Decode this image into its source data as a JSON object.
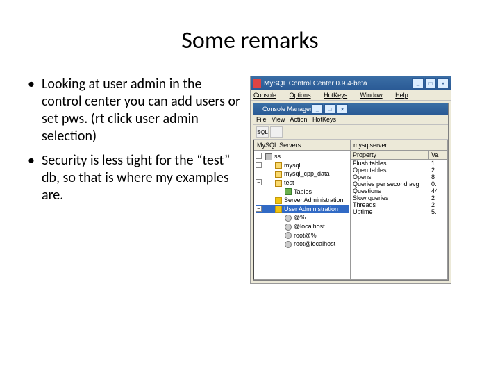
{
  "slide": {
    "title": "Some remarks",
    "bullets": [
      "Looking at user admin in the control center you can add users or set pws. (rt click user admin selection)",
      "Security is less tight for the “test” db, so that is where my examples are."
    ]
  },
  "app": {
    "title": "MySQL Control Center 0.9.4-beta",
    "menu": {
      "console": "Console",
      "options": "Options",
      "hotkeys": "HotKeys",
      "window": "Window",
      "help": "Help"
    }
  },
  "inner": {
    "title": "Console Manager",
    "menu": {
      "file": "File",
      "view": "View",
      "action": "Action",
      "hotkeys": "HotKeys"
    },
    "toolbar_icon": "SQL"
  },
  "tree": {
    "header": "MySQL Servers",
    "root_exp": "−",
    "root": "ss",
    "child_exp": "−",
    "databases": [
      "mysql",
      "mysql_cpp_data",
      "test"
    ],
    "tables_label": "Tables",
    "server_admin": "Server Administration",
    "user_admin": "User Administration",
    "user_admin_exp": "−",
    "users": [
      "@%",
      "@localhost",
      "root@%",
      "root@localhost"
    ]
  },
  "right": {
    "header": "mysqlserver",
    "col_property": "Property",
    "col_value": "Va",
    "rows": [
      {
        "p": "Flush tables",
        "v": "1"
      },
      {
        "p": "Open tables",
        "v": "2"
      },
      {
        "p": "Opens",
        "v": "8"
      },
      {
        "p": "Queries per second avg",
        "v": "0."
      },
      {
        "p": "Questions",
        "v": "44"
      },
      {
        "p": "Slow queries",
        "v": "2"
      },
      {
        "p": "Threads",
        "v": "2"
      },
      {
        "p": "Uptime",
        "v": "5."
      }
    ]
  }
}
